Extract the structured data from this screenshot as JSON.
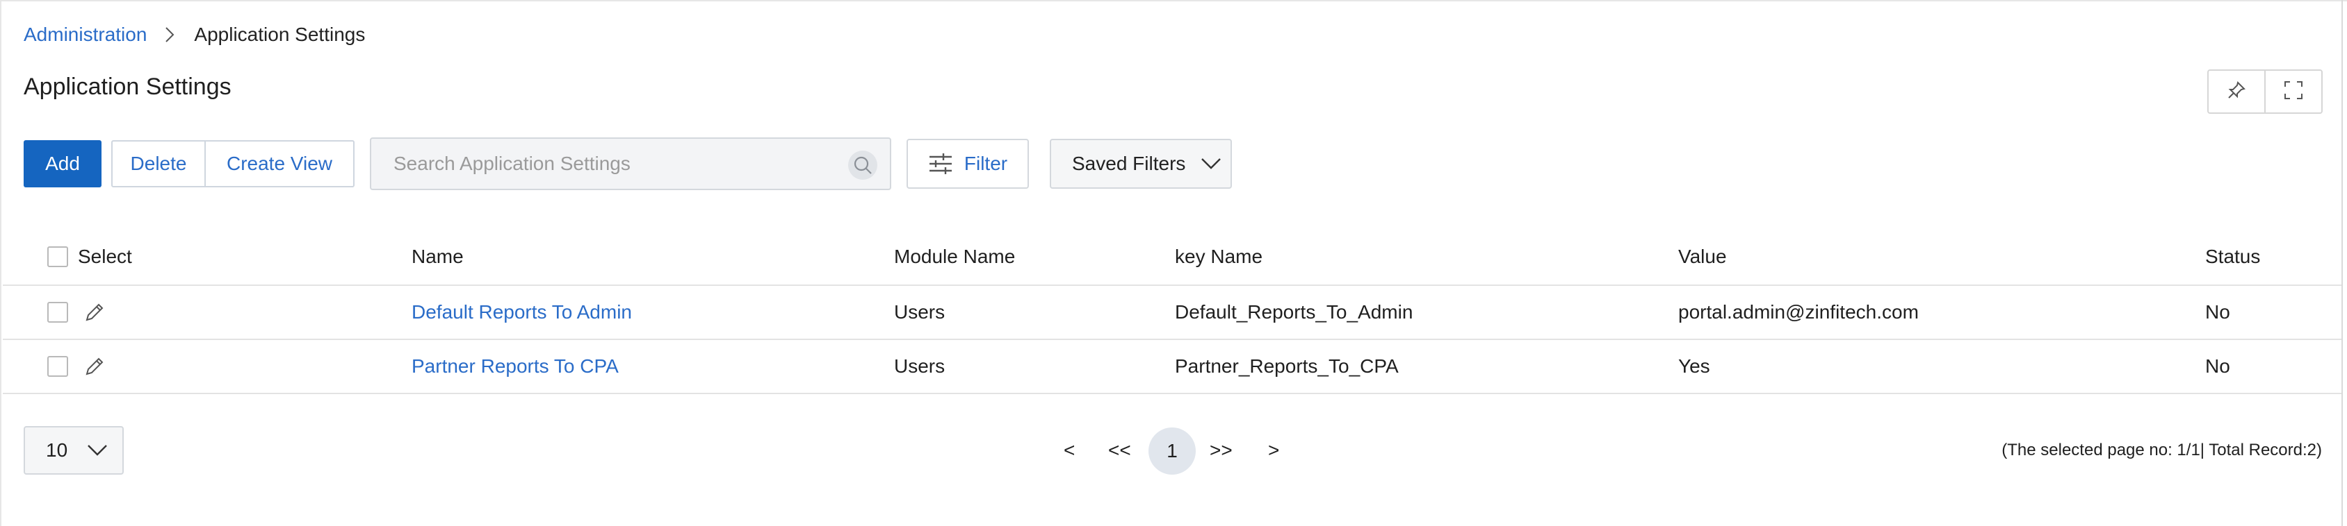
{
  "breadcrumb": {
    "root": "Administration",
    "current": "Application Settings"
  },
  "page": {
    "title": "Application Settings"
  },
  "toolbar": {
    "add_label": "Add",
    "delete_label": "Delete",
    "create_view_label": "Create View",
    "search_placeholder": "Search Application Settings",
    "filter_label": "Filter",
    "saved_filters_label": "Saved Filters"
  },
  "table": {
    "columns": [
      "Select",
      "Name",
      "Module Name",
      "key Name",
      "Value",
      "Status"
    ],
    "rows": [
      {
        "name": "Default Reports To Admin",
        "module": "Users",
        "key": "Default_Reports_To_Admin",
        "value": "portal.admin@zinfitech.com",
        "status": "No"
      },
      {
        "name": "Partner Reports To CPA",
        "module": "Users",
        "key": "Partner_Reports_To_CPA",
        "value": "Yes",
        "status": "No"
      }
    ]
  },
  "pagination": {
    "page_size": "10",
    "prev": "<",
    "first": "<<",
    "current": "1",
    "last": ">>",
    "next": ">",
    "summary": "(The selected page no: 1/1| Total Record:2)"
  },
  "colors": {
    "primary": "#1565c0",
    "link": "#2a6cc8",
    "border": "#d4d8dd"
  },
  "icons": [
    "chevron-right-icon",
    "pin-icon",
    "fullscreen-icon",
    "search-icon",
    "filter-sliders-icon",
    "chevron-down-icon",
    "edit-pencil-icon"
  ]
}
